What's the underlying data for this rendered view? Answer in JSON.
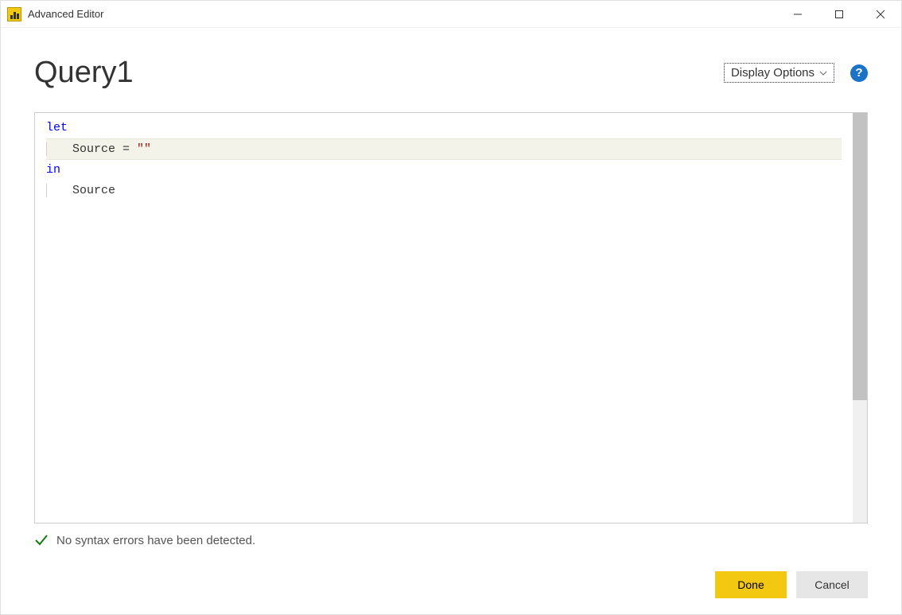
{
  "titleBar": {
    "title": "Advanced Editor"
  },
  "header": {
    "queryTitle": "Query1",
    "displayOptionsLabel": "Display Options",
    "helpLabel": "?"
  },
  "editor": {
    "code": {
      "line1_keyword": "let",
      "line2_indent_var": "Source",
      "line2_op": " = ",
      "line2_string": "\"\"",
      "line3_keyword": "in",
      "line4_indent_var": "Source"
    }
  },
  "status": {
    "message": "No syntax errors have been detected."
  },
  "buttons": {
    "done": "Done",
    "cancel": "Cancel"
  }
}
